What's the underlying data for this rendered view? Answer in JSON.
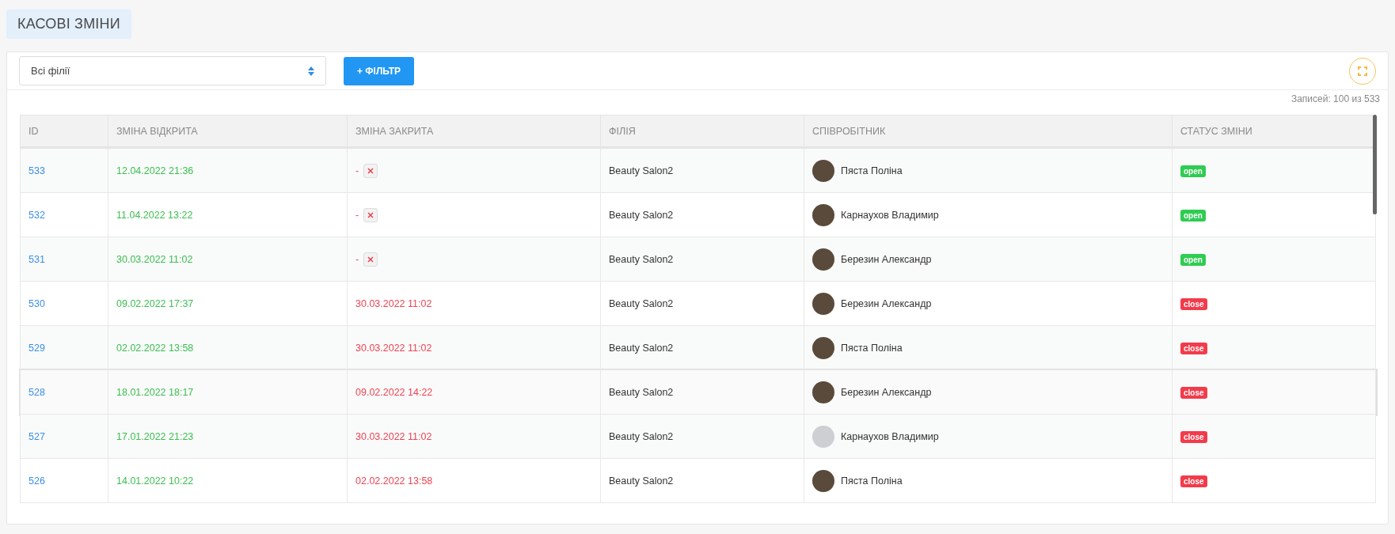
{
  "page_title": "КАСОВІ ЗМІНИ",
  "toolbar": {
    "branch_select": {
      "value": "Всі філії"
    },
    "filter_button": "+ ФІЛЬТР"
  },
  "records_count": "Записей: 100 из 533",
  "table": {
    "columns": [
      "ID",
      "ЗМІНА ВІДКРИТА",
      "ЗМІНА ЗАКРИТА",
      "ФІЛІЯ",
      "СПІВРОБІТНИК",
      "СТАТУС ЗМІНИ"
    ],
    "rows": [
      {
        "id": "533",
        "opened": "12.04.2022 21:36",
        "closed": "-",
        "close_action": true,
        "branch": "Beauty Salon2",
        "employee": "Пяста Поліна",
        "avatar_photo": true,
        "status": {
          "label": "open",
          "kind": "open"
        },
        "hovered": false
      },
      {
        "id": "532",
        "opened": "11.04.2022 13:22",
        "closed": "-",
        "close_action": true,
        "branch": "Beauty Salon2",
        "employee": "Карнаухов Владимир",
        "avatar_photo": true,
        "status": {
          "label": "open",
          "kind": "open"
        },
        "hovered": false
      },
      {
        "id": "531",
        "opened": "30.03.2022 11:02",
        "closed": "-",
        "close_action": true,
        "branch": "Beauty Salon2",
        "employee": "Березин Александр",
        "avatar_photo": true,
        "status": {
          "label": "open",
          "kind": "open"
        },
        "hovered": false
      },
      {
        "id": "530",
        "opened": "09.02.2022 17:37",
        "closed": "30.03.2022 11:02",
        "close_action": false,
        "branch": "Beauty Salon2",
        "employee": "Березин Александр",
        "avatar_photo": true,
        "status": {
          "label": "close",
          "kind": "close"
        },
        "hovered": false
      },
      {
        "id": "529",
        "opened": "02.02.2022 13:58",
        "closed": "30.03.2022 11:02",
        "close_action": false,
        "branch": "Beauty Salon2",
        "employee": "Пяста Поліна",
        "avatar_photo": true,
        "status": {
          "label": "close",
          "kind": "close"
        },
        "hovered": false
      },
      {
        "id": "528",
        "opened": "18.01.2022 18:17",
        "closed": "09.02.2022 14:22",
        "close_action": false,
        "branch": "Beauty Salon2",
        "employee": "Березин Александр",
        "avatar_photo": true,
        "status": {
          "label": "close",
          "kind": "close"
        },
        "hovered": true
      },
      {
        "id": "527",
        "opened": "17.01.2022 21:23",
        "closed": "30.03.2022 11:02",
        "close_action": false,
        "branch": "Beauty Salon2",
        "employee": "Карнаухов Владимир",
        "avatar_photo": false,
        "status": {
          "label": "close",
          "kind": "close"
        },
        "hovered": false
      },
      {
        "id": "526",
        "opened": "14.01.2022 10:22",
        "closed": "02.02.2022 13:58",
        "close_action": false,
        "branch": "Beauty Salon2",
        "employee": "Пяста Поліна",
        "avatar_photo": true,
        "status": {
          "label": "close",
          "kind": "close"
        },
        "hovered": false
      }
    ]
  }
}
